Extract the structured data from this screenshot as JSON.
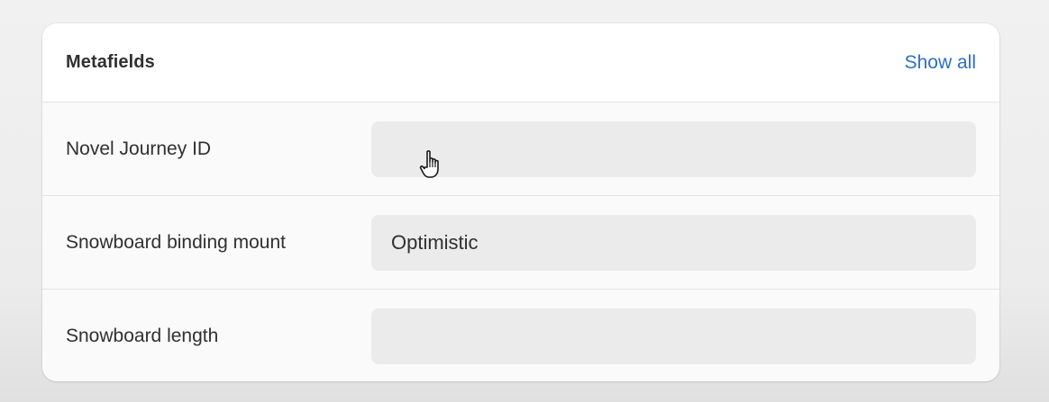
{
  "card": {
    "title": "Metafields",
    "show_all_label": "Show all"
  },
  "fields": [
    {
      "label": "Novel Journey ID",
      "value": ""
    },
    {
      "label": "Snowboard binding mount",
      "value": "Optimistic"
    },
    {
      "label": "Snowboard length",
      "value": ""
    }
  ],
  "colors": {
    "link": "#2c6ecb",
    "input_bg": "#ebebeb",
    "text": "#303030"
  },
  "icons": {
    "cursor": "hand-pointer-icon"
  }
}
